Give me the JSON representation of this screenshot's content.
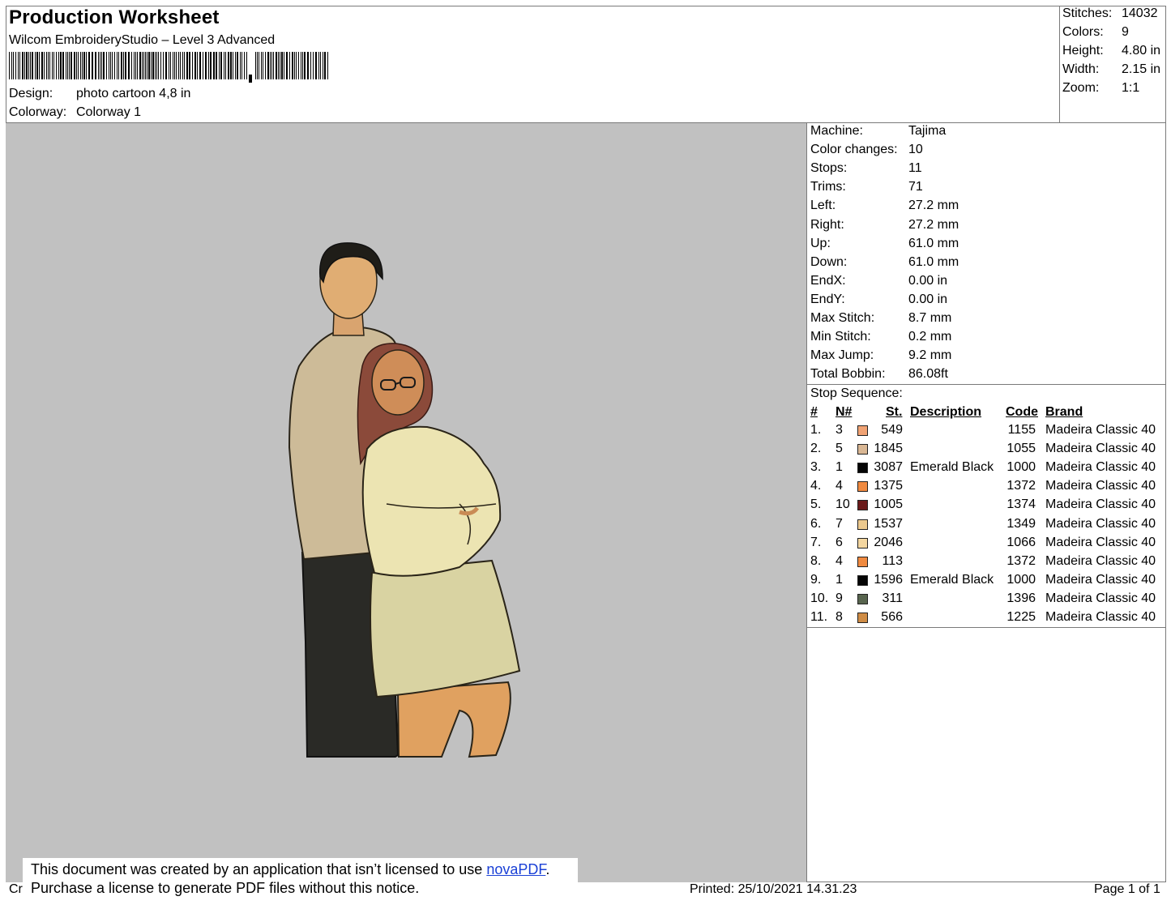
{
  "header": {
    "title": "Production Worksheet",
    "software": "Wilcom EmbroideryStudio – Level 3 Advanced",
    "design_label": "Design:",
    "design_value": "photo cartoon 4,8 in",
    "colorway_label": "Colorway:",
    "colorway_value": "Colorway 1"
  },
  "summary": [
    {
      "label": "Stitches:",
      "value": "14032"
    },
    {
      "label": "Colors:",
      "value": "9"
    },
    {
      "label": "Height:",
      "value": "4.80 in"
    },
    {
      "label": "Width:",
      "value": "2.15 in"
    },
    {
      "label": "Zoom:",
      "value": "1:1"
    }
  ],
  "machine_info": [
    {
      "label": "Machine:",
      "value": "Tajima"
    },
    {
      "label": "Color changes:",
      "value": "10"
    },
    {
      "label": "Stops:",
      "value": "11"
    },
    {
      "label": "Trims:",
      "value": "71"
    },
    {
      "label": "Left:",
      "value": "27.2 mm"
    },
    {
      "label": "Right:",
      "value": "27.2 mm"
    },
    {
      "label": "Up:",
      "value": "61.0 mm"
    },
    {
      "label": "Down:",
      "value": "61.0 mm"
    },
    {
      "label": "EndX:",
      "value": "0.00 in"
    },
    {
      "label": "EndY:",
      "value": "0.00 in"
    },
    {
      "label": "Max Stitch:",
      "value": "8.7 mm"
    },
    {
      "label": "Min Stitch:",
      "value": "0.2 mm"
    },
    {
      "label": "Max Jump:",
      "value": "9.2 mm"
    },
    {
      "label": "Total Bobbin:",
      "value": "86.08ft"
    }
  ],
  "stop_sequence": {
    "title": "Stop Sequence:",
    "headers": {
      "num": "#",
      "n": "N#",
      "st": "St.",
      "description": "Description",
      "code": "Code",
      "brand": "Brand"
    },
    "rows": [
      {
        "num": "1.",
        "n": "3",
        "color": "#f1a374",
        "st": "549",
        "description": "",
        "code": "1155",
        "brand": "Madeira Classic 40"
      },
      {
        "num": "2.",
        "n": "5",
        "color": "#d9b794",
        "st": "1845",
        "description": "",
        "code": "1055",
        "brand": "Madeira Classic 40"
      },
      {
        "num": "3.",
        "n": "1",
        "color": "#050505",
        "st": "3087",
        "description": "Emerald Black",
        "code": "1000",
        "brand": "Madeira Classic 40"
      },
      {
        "num": "4.",
        "n": "4",
        "color": "#f08a40",
        "st": "1375",
        "description": "",
        "code": "1372",
        "brand": "Madeira Classic 40"
      },
      {
        "num": "5.",
        "n": "10",
        "color": "#6b1a1a",
        "st": "1005",
        "description": "",
        "code": "1374",
        "brand": "Madeira Classic 40"
      },
      {
        "num": "6.",
        "n": "7",
        "color": "#ecc98e",
        "st": "1537",
        "description": "",
        "code": "1349",
        "brand": "Madeira Classic 40"
      },
      {
        "num": "7.",
        "n": "6",
        "color": "#f3d6a0",
        "st": "2046",
        "description": "",
        "code": "1066",
        "brand": "Madeira Classic 40"
      },
      {
        "num": "8.",
        "n": "4",
        "color": "#f08a40",
        "st": "113",
        "description": "",
        "code": "1372",
        "brand": "Madeira Classic 40"
      },
      {
        "num": "9.",
        "n": "1",
        "color": "#050505",
        "st": "1596",
        "description": "Emerald Black",
        "code": "1000",
        "brand": "Madeira Classic 40"
      },
      {
        "num": "10.",
        "n": "9",
        "color": "#58654f",
        "st": "311",
        "description": "",
        "code": "1396",
        "brand": "Madeira Classic 40"
      },
      {
        "num": "11.",
        "n": "8",
        "color": "#cf8c45",
        "st": "566",
        "description": "",
        "code": "1225",
        "brand": "Madeira Classic 40"
      }
    ]
  },
  "footer": {
    "left_text": "Cr",
    "printed": "Printed: 25/10/2021 14.31.23",
    "page": "Page 1 of 1"
  },
  "notice": {
    "line1_prefix": "This document was created by an application that isn’t licensed to use ",
    "link": "novaPDF",
    "line1_suffix": ".",
    "line2": "Purchase a license to generate PDF files without this notice."
  }
}
